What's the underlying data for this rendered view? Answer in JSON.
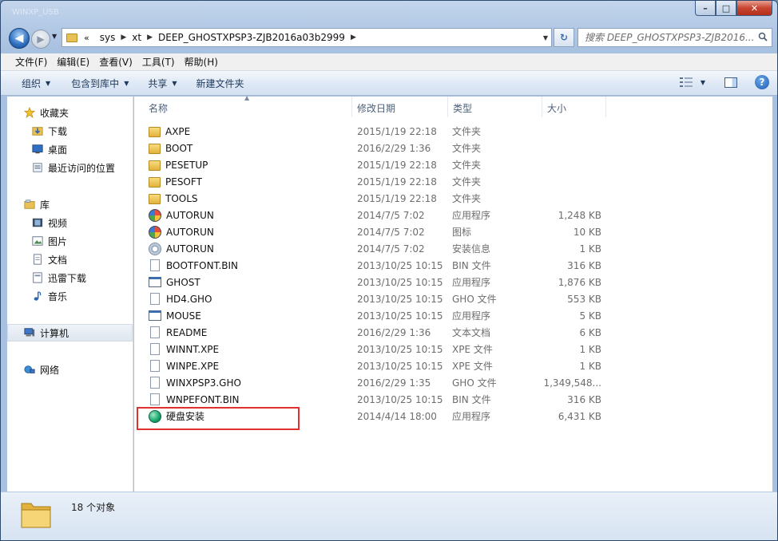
{
  "window": {
    "title_faded": "WINXP_USB",
    "caption_minimize": "–",
    "caption_maximize": "□",
    "caption_close": "✕"
  },
  "address": {
    "lead_chevron": "«",
    "crumbs": [
      "sys",
      "xt",
      "DEEP_GHOSTXPSP3-ZJB2016a03b2999"
    ]
  },
  "search": {
    "placeholder": "搜索 DEEP_GHOSTXPSP3-ZJB2016..."
  },
  "menu": [
    "文件(F)",
    "编辑(E)",
    "查看(V)",
    "工具(T)",
    "帮助(H)"
  ],
  "commands": {
    "organize": "组织",
    "include_library": "包含到库中",
    "share": "共享",
    "new_folder": "新建文件夹"
  },
  "nav": {
    "favorites": "收藏夹",
    "downloads": "下载",
    "desktop": "桌面",
    "recent": "最近访问的位置",
    "libraries": "库",
    "videos": "视频",
    "pictures": "图片",
    "documents": "文档",
    "xunlei": "迅雷下载",
    "music": "音乐",
    "computer": "计算机",
    "network": "网络"
  },
  "columns": {
    "name": "名称",
    "date": "修改日期",
    "type": "类型",
    "size": "大小"
  },
  "files": [
    {
      "name": "AXPE",
      "date": "2015/1/19 22:18",
      "type": "文件夹",
      "size": "",
      "icon": "folder-icon"
    },
    {
      "name": "BOOT",
      "date": "2016/2/29 1:36",
      "type": "文件夹",
      "size": "",
      "icon": "folder-icon"
    },
    {
      "name": "PESETUP",
      "date": "2015/1/19 22:18",
      "type": "文件夹",
      "size": "",
      "icon": "folder-icon"
    },
    {
      "name": "PESOFT",
      "date": "2015/1/19 22:18",
      "type": "文件夹",
      "size": "",
      "icon": "folder-icon"
    },
    {
      "name": "TOOLS",
      "date": "2015/1/19 22:18",
      "type": "文件夹",
      "size": "",
      "icon": "folder-icon"
    },
    {
      "name": "AUTORUN",
      "date": "2014/7/5 7:02",
      "type": "应用程序",
      "size": "1,248 KB",
      "icon": "autorun-exe-icon"
    },
    {
      "name": "AUTORUN",
      "date": "2014/7/5 7:02",
      "type": "图标",
      "size": "10 KB",
      "icon": "autorun-ico-icon"
    },
    {
      "name": "AUTORUN",
      "date": "2014/7/5 7:02",
      "type": "安装信息",
      "size": "1 KB",
      "icon": "setup-info-icon"
    },
    {
      "name": "BOOTFONT.BIN",
      "date": "2013/10/25 10:15",
      "type": "BIN 文件",
      "size": "316 KB",
      "icon": "file-icon"
    },
    {
      "name": "GHOST",
      "date": "2013/10/25 10:15",
      "type": "应用程序",
      "size": "1,876 KB",
      "icon": "app-icon"
    },
    {
      "name": "HD4.GHO",
      "date": "2013/10/25 10:15",
      "type": "GHO 文件",
      "size": "553 KB",
      "icon": "file-icon"
    },
    {
      "name": "MOUSE",
      "date": "2013/10/25 10:15",
      "type": "应用程序",
      "size": "5 KB",
      "icon": "app-icon"
    },
    {
      "name": "README",
      "date": "2016/2/29 1:36",
      "type": "文本文档",
      "size": "6 KB",
      "icon": "text-file-icon"
    },
    {
      "name": "WINNT.XPE",
      "date": "2013/10/25 10:15",
      "type": "XPE 文件",
      "size": "1 KB",
      "icon": "file-icon"
    },
    {
      "name": "WINPE.XPE",
      "date": "2013/10/25 10:15",
      "type": "XPE 文件",
      "size": "1 KB",
      "icon": "file-icon"
    },
    {
      "name": "WINXPSP3.GHO",
      "date": "2016/2/29 1:35",
      "type": "GHO 文件",
      "size": "1,349,548...",
      "icon": "file-icon"
    },
    {
      "name": "WNPEFONT.BIN",
      "date": "2013/10/25 10:15",
      "type": "BIN 文件",
      "size": "316 KB",
      "icon": "file-icon"
    },
    {
      "name": "硬盘安装",
      "date": "2014/4/14 18:00",
      "type": "应用程序",
      "size": "6,431 KB",
      "icon": "hard-disk-install-icon"
    }
  ],
  "status": {
    "count": "18 个对象"
  },
  "colors": {
    "highlight_box": "#e03030"
  }
}
